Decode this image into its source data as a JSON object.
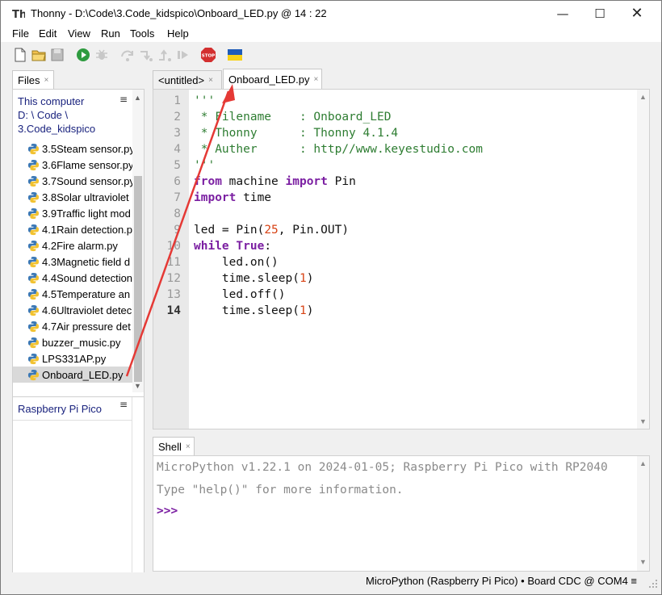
{
  "window": {
    "title": "Thonny  -  D:\\Code\\3.Code_kidspico\\Onboard_LED.py  @  14 : 22",
    "minimize_glyph": "—",
    "maximize_glyph": "☐",
    "close_glyph": "✕"
  },
  "menu": [
    "File",
    "Edit",
    "View",
    "Run",
    "Tools",
    "Help"
  ],
  "toolbar": {
    "icons": [
      "new-file-icon",
      "open-folder-icon",
      "save-icon",
      "run-icon",
      "debug-icon",
      "step-over-icon",
      "step-into-icon",
      "step-out-icon",
      "resume-icon",
      "stop-icon",
      "ukraine-flag-icon"
    ],
    "stop_label": "STOP"
  },
  "files": {
    "tab_label": "Files",
    "tab_close": "×",
    "path_lines": [
      "This computer",
      "D: \\ Code \\",
      "3.Code_kidspico"
    ],
    "menu_glyph": "≡",
    "items": [
      "3.5Steam sensor.py",
      "3.6Flame sensor.py",
      "3.7Sound sensor.py",
      "3.8Solar ultraviolet",
      "3.9Traffic light mod",
      "4.1Rain detection.p",
      "4.2Fire alarm.py",
      "4.3Magnetic field d",
      "4.4Sound detection",
      "4.5Temperature an",
      "4.6Ultraviolet detec",
      "4.7Air pressure det",
      "buzzer_music.py",
      "LPS331AP.py",
      "Onboard_LED.py"
    ],
    "selected_index": 14,
    "device_label": "Raspberry Pi Pico"
  },
  "editor": {
    "tabs": [
      {
        "label": "<untitled>",
        "close": "×",
        "active": false
      },
      {
        "label": "Onboard_LED.py",
        "close": "×",
        "active": true
      }
    ],
    "line_numbers": [
      "1",
      "2",
      "3",
      "4",
      "5",
      "6",
      "7",
      "8",
      "9",
      "10",
      "11",
      "12",
      "13",
      "14"
    ],
    "current_line": 14,
    "code": {
      "l1": "'''",
      "l2": " * Filename    : Onboard_LED",
      "l3": " * Thonny      : Thonny 4.1.4",
      "l4": " * Auther      : http//www.keyestudio.com",
      "l5": "'''",
      "l6_kw1": "from",
      "l6_mid": " machine ",
      "l6_kw2": "import",
      "l6_end": " Pin",
      "l7_kw": "import",
      "l7_end": " time",
      "l9_a": "led = Pin(",
      "l9_num": "25",
      "l9_b": ", Pin.OUT)",
      "l10_kw": "while",
      "l10_sp": " ",
      "l10_kw2": "True",
      "l10_end": ":",
      "l11": "    led.on()",
      "l12_a": "    time.sleep(",
      "l12_num": "1",
      "l12_b": ")",
      "l13": "    led.off()",
      "l14_a": "    time.sleep(",
      "l14_num": "1",
      "l14_b": ")"
    }
  },
  "shell": {
    "tab_label": "Shell",
    "tab_close": "×",
    "banner": "MicroPython v1.22.1 on 2024-01-05; Raspberry Pi Pico with RP2040",
    "help": "Type \"help()\" for more information.",
    "prompt": ">>>"
  },
  "status": {
    "text": "MicroPython (Raspberry Pi Pico)  •  Board CDC @ COM4  ≡"
  },
  "colors": {
    "annotation_arrow": "#e53935",
    "keyword": "#7b1fa2",
    "string": "#2e7d32",
    "number": "#d84315",
    "path_text": "#1a237e"
  }
}
